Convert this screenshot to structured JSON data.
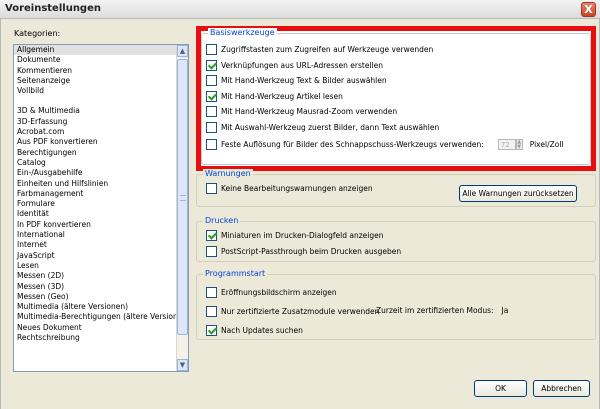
{
  "window": {
    "title": "Voreinstellungen",
    "close_label": "X"
  },
  "categories": {
    "label": "Kategorien:",
    "group1": [
      "Allgemein",
      "Dokumente",
      "Kommentieren",
      "Seitenanzeige",
      "Vollbild"
    ],
    "group2": [
      "3D & Multimedia",
      "3D-Erfassung",
      "Acrobat.com",
      "Aus PDF konvertieren",
      "Berechtigungen",
      "Catalog",
      "Ein-/Ausgabehilfe",
      "Einheiten und Hilfslinien",
      "Farbmanagement",
      "Formulare",
      "Identität",
      "In PDF konvertieren",
      "International",
      "Internet",
      "JavaScript",
      "Lesen",
      "Messen (2D)",
      "Messen (3D)",
      "Messen (Geo)",
      "Multimedia (ältere Versionen)",
      "Multimedia-Berechtigungen (ältere Versionen)",
      "Neues Dokument",
      "Rechtschreibung"
    ],
    "selected": "Allgemein"
  },
  "basiswerkzeuge": {
    "title": "Basiswerkzeuge",
    "options": [
      {
        "label": "Zugriffstasten zum Zugreifen auf Werkzeuge verwenden",
        "checked": false
      },
      {
        "label": "Verknüpfungen aus URL-Adressen erstellen",
        "checked": true
      },
      {
        "label": "Mit Hand-Werkzeug Text & Bilder auswählen",
        "checked": false
      },
      {
        "label": "Mit Hand-Werkzeug Artikel lesen",
        "checked": true
      },
      {
        "label": "Mit Hand-Werkzeug Mausrad-Zoom verwenden",
        "checked": false
      },
      {
        "label": "Mit Auswahl-Werkzeug zuerst Bilder, dann Text auswählen",
        "checked": false
      }
    ],
    "resolution_label": "Feste Auflösung für Bilder des Schnappschuss-Werkzeugs verwenden:",
    "resolution_checked": false,
    "resolution_value": "72",
    "resolution_unit": "Pixel/Zoll"
  },
  "warnungen": {
    "title": "Warnungen",
    "option_label": "Keine Bearbeitungswarnungen anzeigen",
    "reset_button": "Alle Warnungen zurücksetzen"
  },
  "drucken": {
    "title": "Drucken",
    "options": [
      {
        "label": "Miniaturen im Drucken-Dialogfeld anzeigen",
        "checked": true
      },
      {
        "label": "PostScript-Passthrough beim Drucken ausgeben",
        "checked": false
      }
    ]
  },
  "programmstart": {
    "title": "Programmstart",
    "options": [
      {
        "label": "Eröffnungsbildschirm anzeigen",
        "checked": false
      },
      {
        "label": "Nur zertifizierte Zusatzmodule verwenden",
        "checked": false
      },
      {
        "label": "Nach Updates suchen",
        "checked": true
      }
    ],
    "cert_mode_label": "Zurzeit im zertifizierten Modus:",
    "cert_mode_value": "Ja"
  },
  "buttons": {
    "ok": "OK",
    "cancel": "Abbrechen"
  },
  "colors": {
    "highlight": "#e60e0e",
    "group_title": "#0046d5",
    "window_bg": "#ece9d8"
  }
}
